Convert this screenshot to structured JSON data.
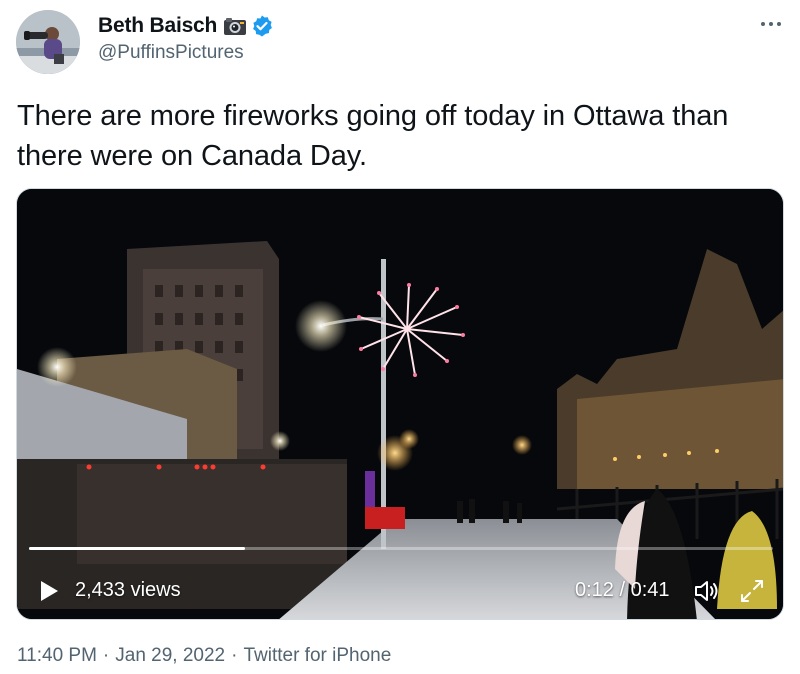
{
  "author": {
    "display_name": "Beth Baisch",
    "handle": "@PuffinsPictures"
  },
  "icons": {
    "camera": "camera-emoji-icon",
    "verified": "verified-badge-icon",
    "more": "more-options-icon",
    "play": "play-icon",
    "volume": "volume-icon",
    "fullscreen": "fullscreen-icon"
  },
  "tweet": {
    "text": "There are more fireworks going off today in Ottawa than there were on Canada Day."
  },
  "video": {
    "views": "2,433 views",
    "time": "0:12 / 0:41",
    "progress": 0.29
  },
  "meta": {
    "time": "11:40 PM",
    "date": "Jan 29, 2022",
    "source": "Twitter for iPhone",
    "separator": "·"
  },
  "colors": {
    "text_primary": "#0f1419",
    "text_secondary": "#536471",
    "verified": "#1d9bf0"
  }
}
